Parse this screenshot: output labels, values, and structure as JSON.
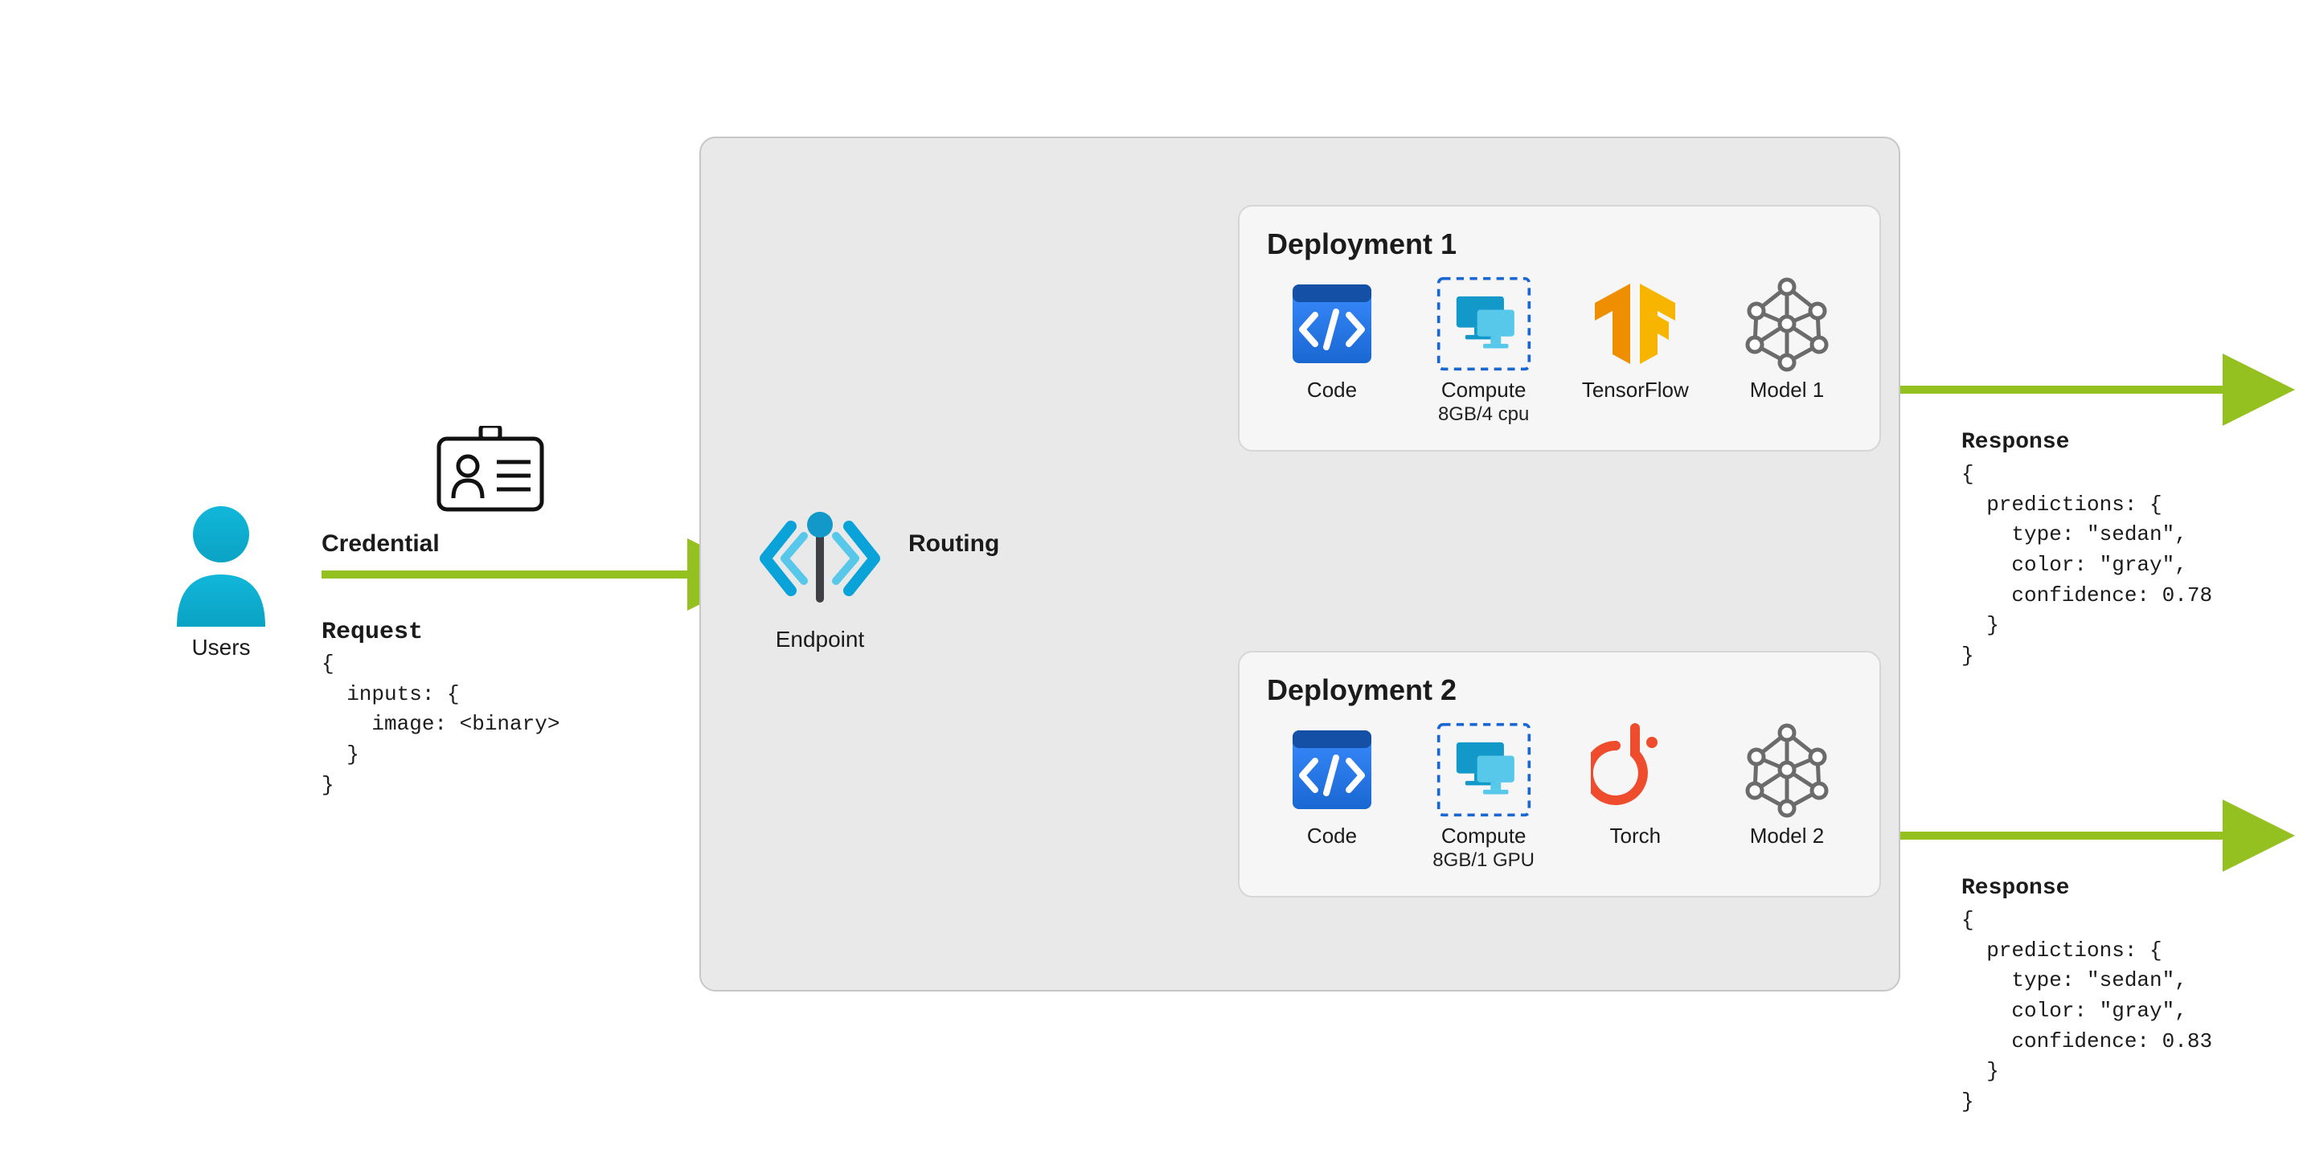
{
  "users_label": "Users",
  "credential_label": "Credential",
  "request_title": "Request",
  "request_body": "{\n  inputs: {\n    image: <binary>\n  }\n}",
  "routing_label": "Routing",
  "endpoint_label": "Endpoint",
  "deployments": [
    {
      "title": "Deployment 1",
      "code_label": "Code",
      "compute_label": "Compute",
      "compute_spec": "8GB/4 cpu",
      "framework_label": "TensorFlow",
      "model_label": "Model 1"
    },
    {
      "title": "Deployment 2",
      "code_label": "Code",
      "compute_label": "Compute",
      "compute_spec": "8GB/1 GPU",
      "framework_label": "Torch",
      "model_label": "Model 2"
    }
  ],
  "responses": [
    {
      "title": "Response",
      "body": "{\n  predictions: {\n    type: \"sedan\",\n    color: \"gray\",\n    confidence: 0.78\n  }\n}"
    },
    {
      "title": "Response",
      "body": "{\n  predictions: {\n    type: \"sedan\",\n    color: \"gray\",\n    confidence: 0.83\n  }\n}"
    }
  ]
}
